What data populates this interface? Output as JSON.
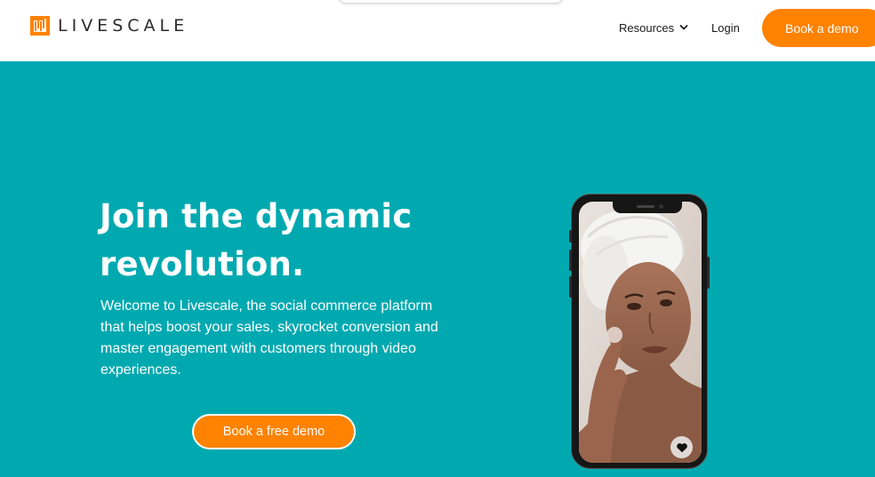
{
  "header": {
    "logo_text": "LIVESCALE",
    "nav": {
      "resources_label": "Resources",
      "login_label": "Login"
    },
    "cta_label": "Book a demo"
  },
  "hero": {
    "title_line1": "Join the dynamic",
    "title_line2": "revolution.",
    "description": "Welcome to Livescale, the social commerce platform that helps boost your sales, skyrocket conversion and master engagement with customers through video experiences.",
    "cta_label": "Book a free demo"
  },
  "colors": {
    "accent": "#ff8200",
    "hero_background": "#00a9b0",
    "header_background": "#ffffff"
  },
  "icons": {
    "logo": "livescale-logo-icon",
    "dropdown": "chevron-down-icon",
    "like": "heart-icon"
  }
}
